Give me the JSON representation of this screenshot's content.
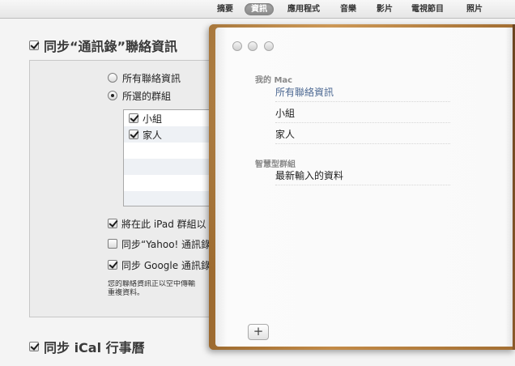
{
  "tabs": [
    {
      "label": "摘要",
      "active": false
    },
    {
      "label": "資訊",
      "active": true
    },
    {
      "label": "應用程式",
      "active": false
    },
    {
      "label": "音樂",
      "active": false
    },
    {
      "label": "影片",
      "active": false
    },
    {
      "label": "電視節目",
      "active": false
    },
    {
      "label": "照片",
      "active": false
    }
  ],
  "contacts_section": {
    "title": "同步“通訊錄”聯絡資訊",
    "checked": true,
    "radio_all": "所有聯絡資訊",
    "radio_selected": "所選的群組",
    "groups": [
      {
        "label": "小組",
        "checked": true
      },
      {
        "label": "家人",
        "checked": true
      }
    ],
    "option_ipad_groups": "將在此 iPad 群組以",
    "option_yahoo": "同步“Yahoo! 通訊錄",
    "option_google": "同步 Google 通訊錄",
    "note_line1": "您的聯絡資訊正以空中傳輸",
    "note_line2": "重複資料。"
  },
  "ical_section": {
    "title": "同步 iCal 行事曆",
    "checked": true
  },
  "address_book": {
    "my_mac_header": "我的 Mac",
    "all_contacts": "所有聯絡資訊",
    "group_small": "小組",
    "group_family": "家人",
    "smart_groups_header": "智慧型群組",
    "recent_imports": "最新輸入的資料",
    "add_label": "+"
  },
  "colors": {
    "selected_text": "#4c6892",
    "leather": "#b07a3a",
    "active_tab": "#999999"
  }
}
